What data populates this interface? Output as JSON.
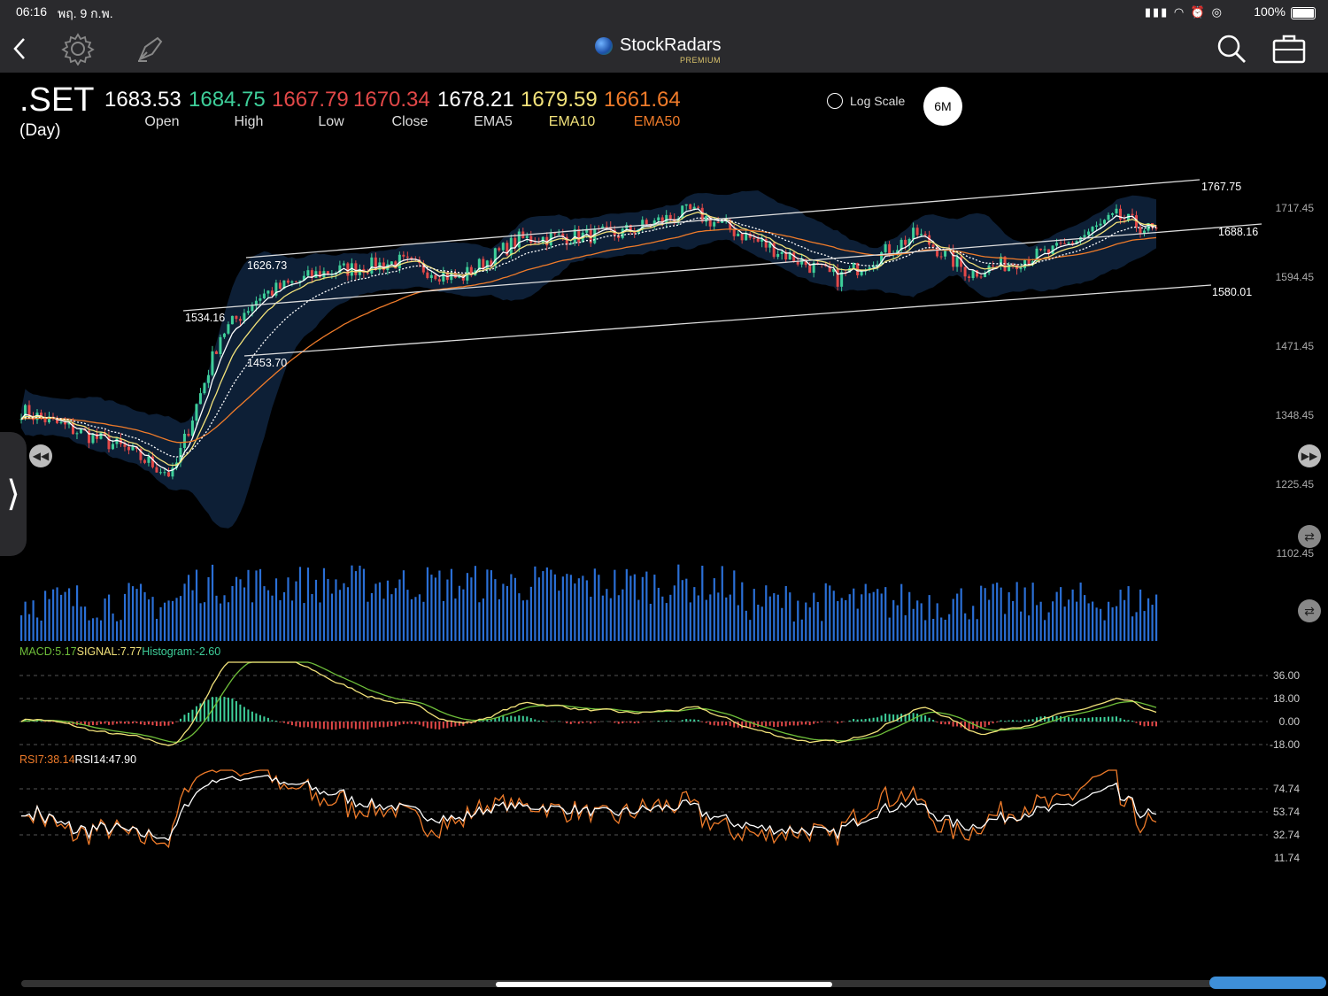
{
  "status_bar": {
    "time": "06:16",
    "date": "พฤ. 9 ก.พ.",
    "battery": "100%"
  },
  "app": {
    "name": "StockRadars",
    "tier": "PREMIUM"
  },
  "quote": {
    "symbol": ".SET",
    "period": "(Day)",
    "fields": [
      {
        "label": "Open",
        "value": "1683.53",
        "color": "#ffffff"
      },
      {
        "label": "High",
        "value": "1684.75",
        "color": "#3ecf9a"
      },
      {
        "label": "Low",
        "value": "1667.79",
        "color": "#e24848"
      },
      {
        "label": "Close",
        "value": "1670.34",
        "color": "#e24848"
      },
      {
        "label": "EMA5",
        "value": "1678.21",
        "color": "#ffffff"
      },
      {
        "label": "EMA10",
        "value": "1679.59",
        "color": "#f2e27a"
      },
      {
        "label": "EMA50",
        "value": "1661.64",
        "color": "#ef7b2a"
      }
    ]
  },
  "controls": {
    "log_scale_label": "Log Scale",
    "log_scale_checked": false,
    "range": "6M"
  },
  "price_axis": {
    "ticks": [
      "1717.45",
      "1594.45",
      "1471.45",
      "1348.45",
      "1225.45",
      "1102.45"
    ]
  },
  "trendlines": {
    "labels": [
      "1767.75",
      "1688.16",
      "1580.01",
      "1626.73",
      "1534.16",
      "1453.70"
    ]
  },
  "macd": {
    "macd_label": "MACD:5.17",
    "signal_label": "SIGNAL:7.77",
    "hist_label": "Histogram:-2.60",
    "ticks": [
      "36.00",
      "18.00",
      "0.00",
      "-18.00"
    ]
  },
  "rsi": {
    "rsi7_label": "RSI7:38.14",
    "rsi14_label": "RSI14:47.90",
    "ticks": [
      "74.74",
      "53.74",
      "32.74",
      "11.74"
    ]
  },
  "colors": {
    "up": "#3ecf9a",
    "down": "#e24848",
    "volume": "#2a6fd6",
    "band": "#0f2540",
    "ema10": "#f2e27a",
    "ema50": "#ef7b2a",
    "macd": "#f2e27a",
    "signal": "#6fbf3a",
    "rsi7": "#ef7b2a",
    "rsi14": "#ffffff"
  },
  "chart_data": {
    "type": "line",
    "title": ".SET (Day)",
    "series_close_keypoints": [
      {
        "t": 0,
        "v": 1355
      },
      {
        "t": 25,
        "v": 1290
      },
      {
        "t": 38,
        "v": 1240
      },
      {
        "t": 50,
        "v": 1490
      },
      {
        "t": 60,
        "v": 1560
      },
      {
        "t": 75,
        "v": 1600
      },
      {
        "t": 95,
        "v": 1620
      },
      {
        "t": 110,
        "v": 1590
      },
      {
        "t": 125,
        "v": 1660
      },
      {
        "t": 150,
        "v": 1670
      },
      {
        "t": 168,
        "v": 1710
      },
      {
        "t": 190,
        "v": 1640
      },
      {
        "t": 205,
        "v": 1590
      },
      {
        "t": 225,
        "v": 1670
      },
      {
        "t": 238,
        "v": 1600
      },
      {
        "t": 260,
        "v": 1640
      },
      {
        "t": 275,
        "v": 1700
      },
      {
        "t": 285,
        "v": 1672
      }
    ],
    "ylim": [
      1102.45,
      1717.45
    ]
  }
}
